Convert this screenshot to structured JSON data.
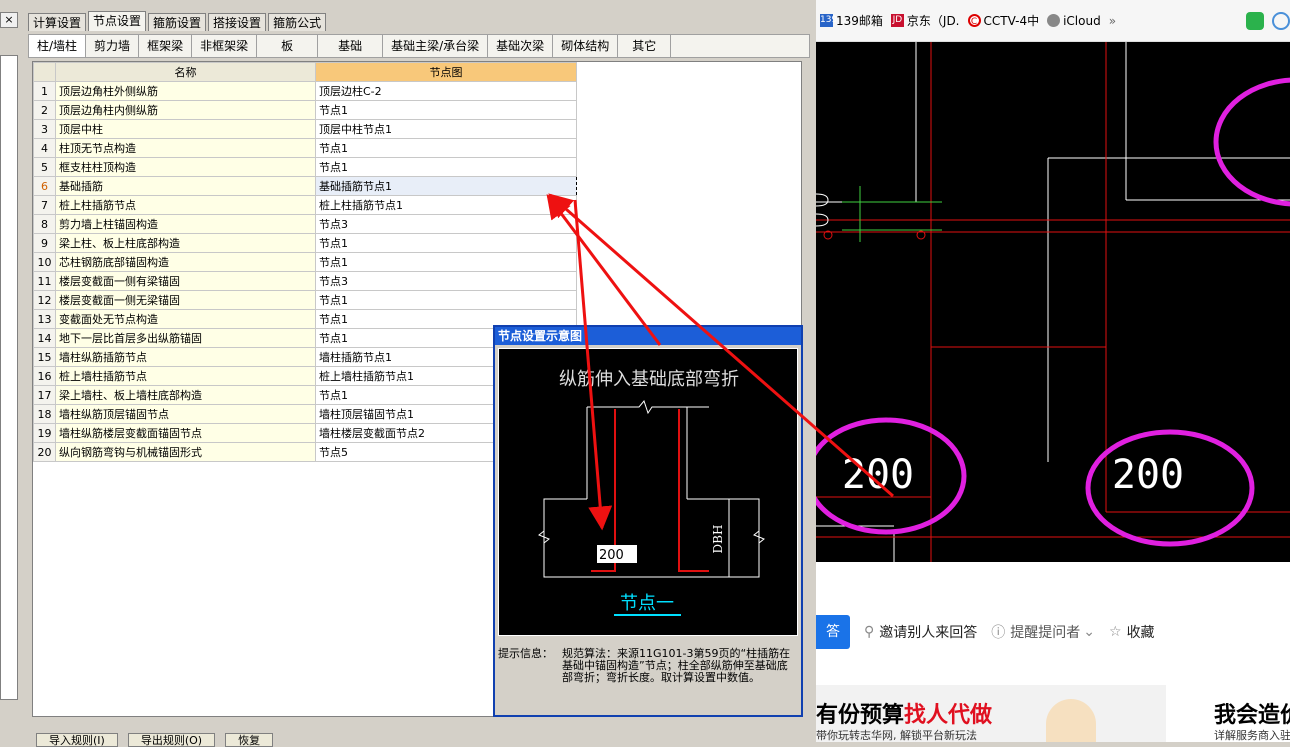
{
  "left_panel": {
    "close_symbol": "×"
  },
  "main_tabs": [
    "计算设置",
    "节点设置",
    "箍筋设置",
    "搭接设置",
    "箍筋公式"
  ],
  "sub_tabs": [
    "柱/墙柱",
    "剪力墙",
    "框架梁",
    "非框架梁",
    "板",
    "基础",
    "基础主梁/承台梁",
    "基础次梁",
    "砌体结构",
    "其它"
  ],
  "table": {
    "headers": {
      "name": "名称",
      "node": "节点图"
    },
    "rows": [
      {
        "num": "1",
        "name": "顶层边角柱外侧纵筋",
        "node": "顶层边柱C-2"
      },
      {
        "num": "2",
        "name": "顶层边角柱内侧纵筋",
        "node": "节点1"
      },
      {
        "num": "3",
        "name": "顶层中柱",
        "node": "顶层中柱节点1"
      },
      {
        "num": "4",
        "name": "柱顶无节点构造",
        "node": "节点1"
      },
      {
        "num": "5",
        "name": "框支柱柱顶构造",
        "node": "节点1"
      },
      {
        "num": "6",
        "name": "基础插筋",
        "node": "基础插筋节点1"
      },
      {
        "num": "7",
        "name": "桩上柱插筋节点",
        "node": "桩上柱插筋节点1"
      },
      {
        "num": "8",
        "name": "剪力墙上柱锚固构造",
        "node": "节点3"
      },
      {
        "num": "9",
        "name": "梁上柱、板上柱底部构造",
        "node": "节点1"
      },
      {
        "num": "10",
        "name": "芯柱钢筋底部锚固构造",
        "node": "节点1"
      },
      {
        "num": "11",
        "name": "楼层变截面一侧有梁锚固",
        "node": "节点3"
      },
      {
        "num": "12",
        "name": "楼层变截面一侧无梁锚固",
        "node": "节点1"
      },
      {
        "num": "13",
        "name": "变截面处无节点构造",
        "node": "节点1"
      },
      {
        "num": "14",
        "name": "地下一层比首层多出纵筋锚固",
        "node": "节点1"
      },
      {
        "num": "15",
        "name": "墙柱纵筋插筋节点",
        "node": "墙柱插筋节点1"
      },
      {
        "num": "16",
        "name": "桩上墙柱插筋节点",
        "node": "桩上墙柱插筋节点1"
      },
      {
        "num": "17",
        "name": "梁上墙柱、板上墙柱底部构造",
        "node": "节点1"
      },
      {
        "num": "18",
        "name": "墙柱纵筋顶层锚固节点",
        "node": "墙柱顶层锚固节点1"
      },
      {
        "num": "19",
        "name": "墙柱纵筋楼层变截面锚固节点",
        "node": "墙柱楼层变截面节点2"
      },
      {
        "num": "20",
        "name": "纵向钢筋弯钩与机械锚固形式",
        "node": "节点5"
      }
    ]
  },
  "bottom_buttons": [
    "导入规则(I)",
    "导出规则(O)",
    "恢复"
  ],
  "popup": {
    "title": "节点设置示意图",
    "diagram_title": "纵筋伸入基础底部弯折",
    "dim_label": "DBH",
    "input_value": "200",
    "node_label": "节点一",
    "hint_label": "提示信息：",
    "hint_text": "规范算法：来源11G101-3第59页的“柱插筋在基础中锚固构造”节点；柱全部纵筋伸至基础底部弯折；弯折长度。取计算设置中数值。"
  },
  "browser": {
    "bookmarks": [
      {
        "icon": "139",
        "label": "139邮箱"
      },
      {
        "icon": "JD",
        "label": "京东（JD."
      },
      {
        "icon": "C",
        "label": "CCTV-4中"
      },
      {
        "icon": "",
        "label": "iCloud"
      }
    ],
    "overflow": "»",
    "cad_labels": [
      "200",
      "200"
    ],
    "actions": {
      "answer": "答",
      "invite": "邀请别人来回答",
      "remind": "提醒提问者",
      "collect": "收藏"
    },
    "ad1": {
      "big_black": "有份预算",
      "big_red": "找人代做",
      "small": "带你玩转志华网, 解锁平台新玩法"
    },
    "ad2": {
      "big": "我会造价",
      "small": "详解服务商入驻"
    }
  },
  "colors": {
    "selected_node_border": "#000000",
    "header_node_bg": "#f8c87a",
    "popup_title_bg": "#1c5ed8",
    "cad_magenta": "#e020e0",
    "arrow_red": "#ee1111"
  }
}
